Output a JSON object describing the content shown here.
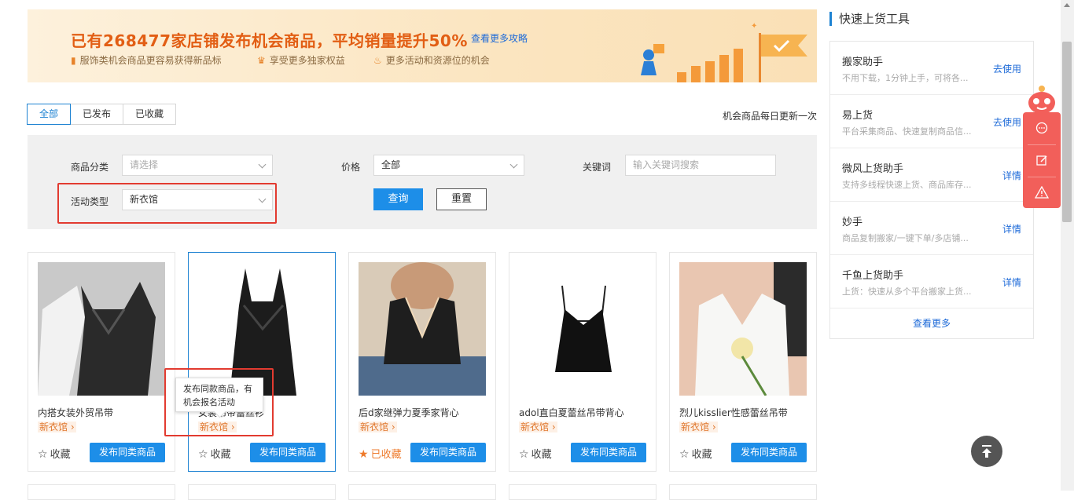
{
  "banner": {
    "title": "已有268477家店铺发布机会商品，平均销量提升50%",
    "link": "查看更多攻略",
    "features": [
      "服饰类机会商品更容易获得新品标",
      "享受更多独家权益",
      "更多活动和资源位的机会"
    ]
  },
  "tabs": [
    "全部",
    "已发布",
    "已收藏"
  ],
  "update_note": "机会商品每日更新一次",
  "filter": {
    "category_label": "商品分类",
    "category_placeholder": "请选择",
    "price_label": "价格",
    "price_value": "全部",
    "keyword_label": "关键词",
    "keyword_placeholder": "输入关键词搜索",
    "activity_label": "活动类型",
    "activity_value": "新衣馆",
    "query_button": "查询",
    "reset_button": "重置"
  },
  "products": [
    {
      "title": "内搭女装外贸吊带",
      "tag": "新衣馆",
      "fav": "收藏",
      "fav_on": false,
      "action": "发布同类商品"
    },
    {
      "title": "女装吊带蕾丝衫",
      "tag": "新衣馆",
      "fav": "收藏",
      "fav_on": false,
      "action": "发布同类商品"
    },
    {
      "title": "后d家继弹力夏季家背心",
      "tag": "新衣馆",
      "fav": "已收藏",
      "fav_on": true,
      "action": "发布同类商品"
    },
    {
      "title": "adol直白夏蕾丝吊带背心",
      "tag": "新衣馆",
      "fav": "收藏",
      "fav_on": false,
      "action": "发布同类商品"
    },
    {
      "title": "烈儿kisslier性感蕾丝吊带",
      "tag": "新衣馆",
      "fav": "收藏",
      "fav_on": false,
      "action": "发布同类商品"
    }
  ],
  "tooltip": "发布同款商品，有机会报名活动",
  "side": {
    "title": "快速上货工具",
    "tools": [
      {
        "name": "搬家助手",
        "desc": "不用下载，1分钟上手，可将各...",
        "action": "去使用"
      },
      {
        "name": "易上货",
        "desc": "平台采集商品、快速复制商品信...",
        "action": "去使用"
      },
      {
        "name": "微风上货助手",
        "desc": "支持多线程快速上货、商品库存...",
        "action": "详情"
      },
      {
        "name": "妙手",
        "desc": "商品复制搬家/一键下单/多店铺...",
        "action": "详情"
      },
      {
        "name": "千鱼上货助手",
        "desc": "上货：快速从多个平台搬家上货...",
        "action": "详情"
      }
    ],
    "more": "查看更多"
  },
  "colors": {
    "accent": "#1d8ee8",
    "banner_title": "#e25e14",
    "tag": "#e0782e",
    "float": "#f25f5a"
  }
}
